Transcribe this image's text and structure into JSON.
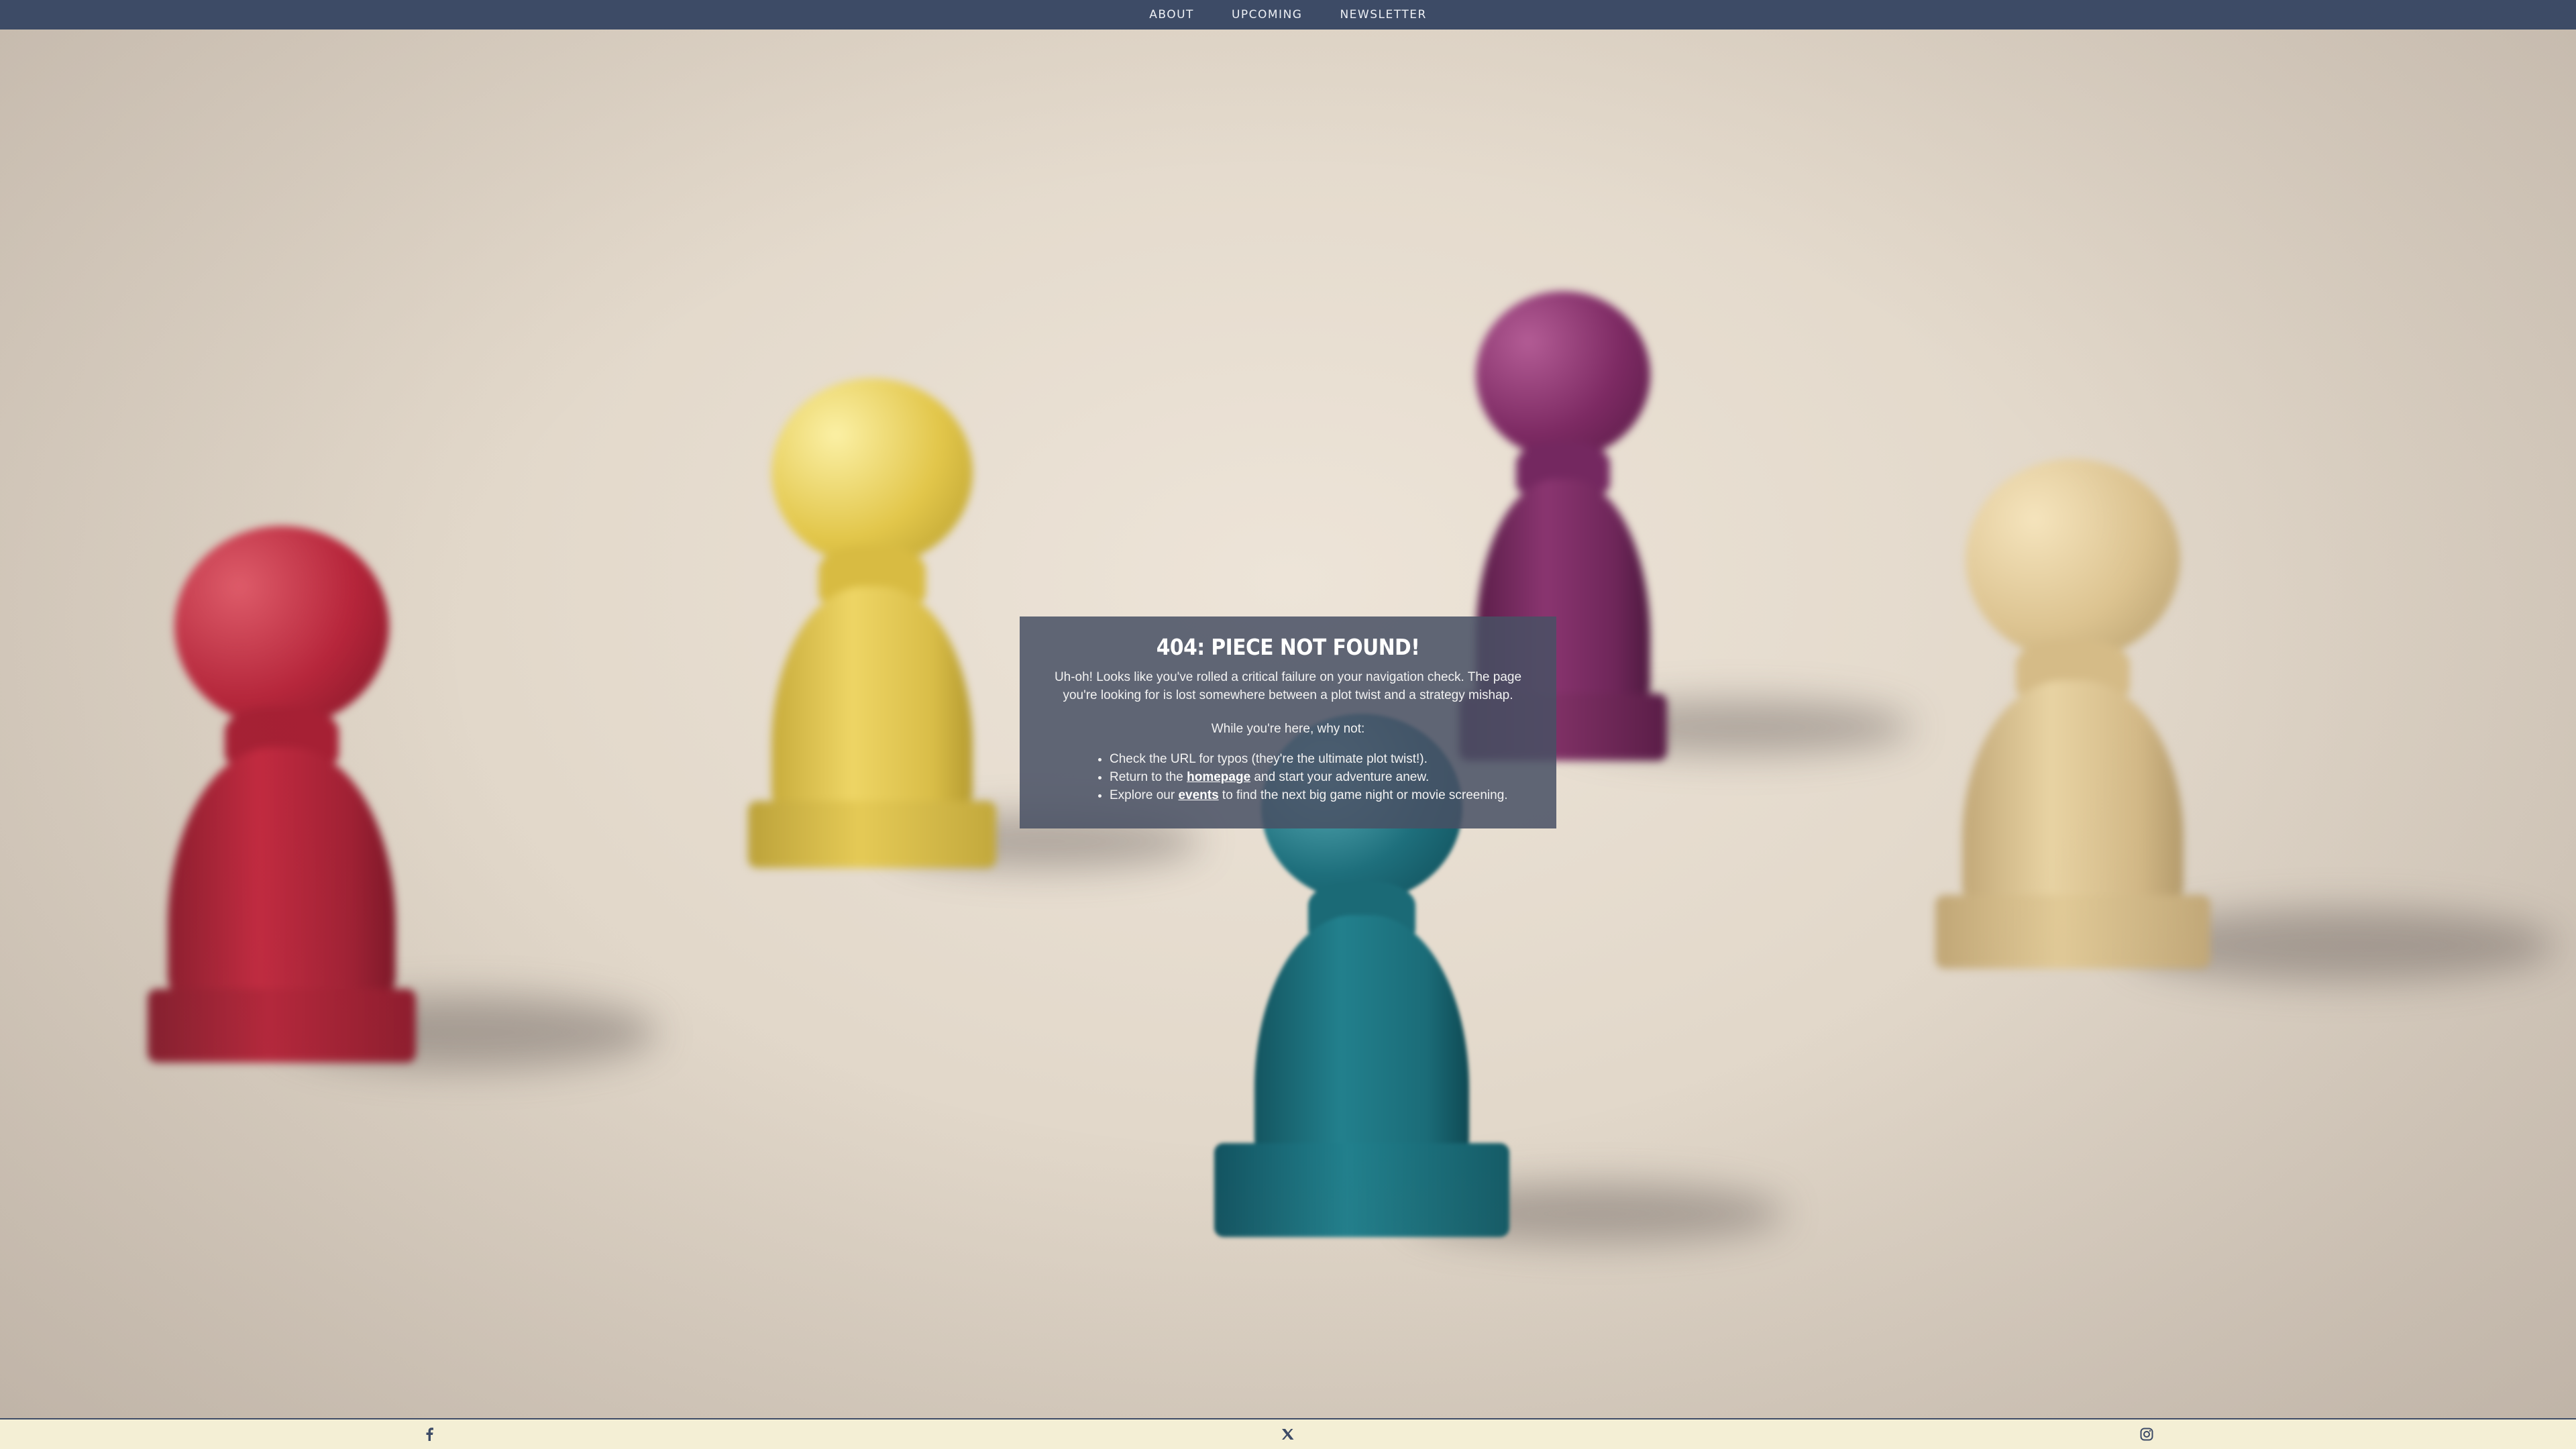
{
  "nav": {
    "items": [
      {
        "label": "ABOUT"
      },
      {
        "label": "UPCOMING"
      },
      {
        "label": "NEWSLETTER"
      }
    ]
  },
  "error_card": {
    "title": "404: PIECE NOT FOUND!",
    "intro": "Uh-oh! Looks like you've rolled a critical failure on your navigation check. The page you're looking for is lost somewhere between a plot twist and a strategy mishap.",
    "prompt": "While you're here, why not:",
    "suggestions": {
      "item1": "Check the URL for typos (they're the ultimate plot twist!).",
      "item2_before": "Return to the ",
      "item2_link": "homepage",
      "item2_after": " and start your adventure anew.",
      "item3_before": "Explore our ",
      "item3_link": "events",
      "item3_after": " to find the next big game night or movie screening."
    }
  },
  "footer": {
    "icons": [
      "facebook-icon",
      "x-icon",
      "instagram-icon"
    ]
  },
  "colors": {
    "nav_bg": "#3d4b66",
    "card_bg": "#485064",
    "footer_bg": "#f4efd5",
    "pawn_red": "#b8243a",
    "pawn_yellow": "#e2c64a",
    "pawn_purple": "#7d2a63",
    "pawn_beige": "#dcc390",
    "pawn_teal": "#1e6f7c"
  }
}
